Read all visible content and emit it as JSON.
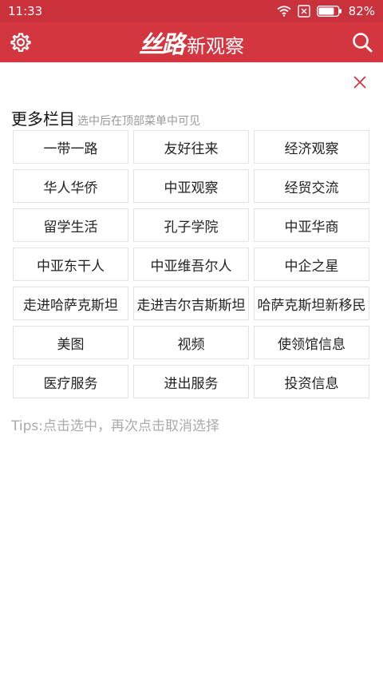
{
  "status_bar": {
    "time": "11:33",
    "battery_percent": "82%",
    "battery_level": 0.82
  },
  "header": {
    "logo_text": "丝路",
    "title_text": "新观察",
    "settings_icon": "gear-icon",
    "search_icon": "search-icon",
    "brand_color": "#d3363f"
  },
  "close_icon": "close-icon",
  "section": {
    "title": "更多栏目",
    "hint": "选中后在顶部菜单中可见"
  },
  "columns": [
    "一带一路",
    "友好往来",
    "经济观察",
    "华人华侨",
    "中亚观察",
    "经贸交流",
    "留学生活",
    "孔子学院",
    "中亚华商",
    "中亚东干人",
    "中亚维吾尔人",
    "中企之星",
    "走进哈萨克斯坦",
    "走进吉尔吉斯斯坦",
    "哈萨克斯坦新移民",
    "美图",
    "视频",
    "使领馆信息",
    "医疗服务",
    "进出服务",
    "投资信息"
  ],
  "tips": "Tips:点击选中，再次点击取消选择"
}
